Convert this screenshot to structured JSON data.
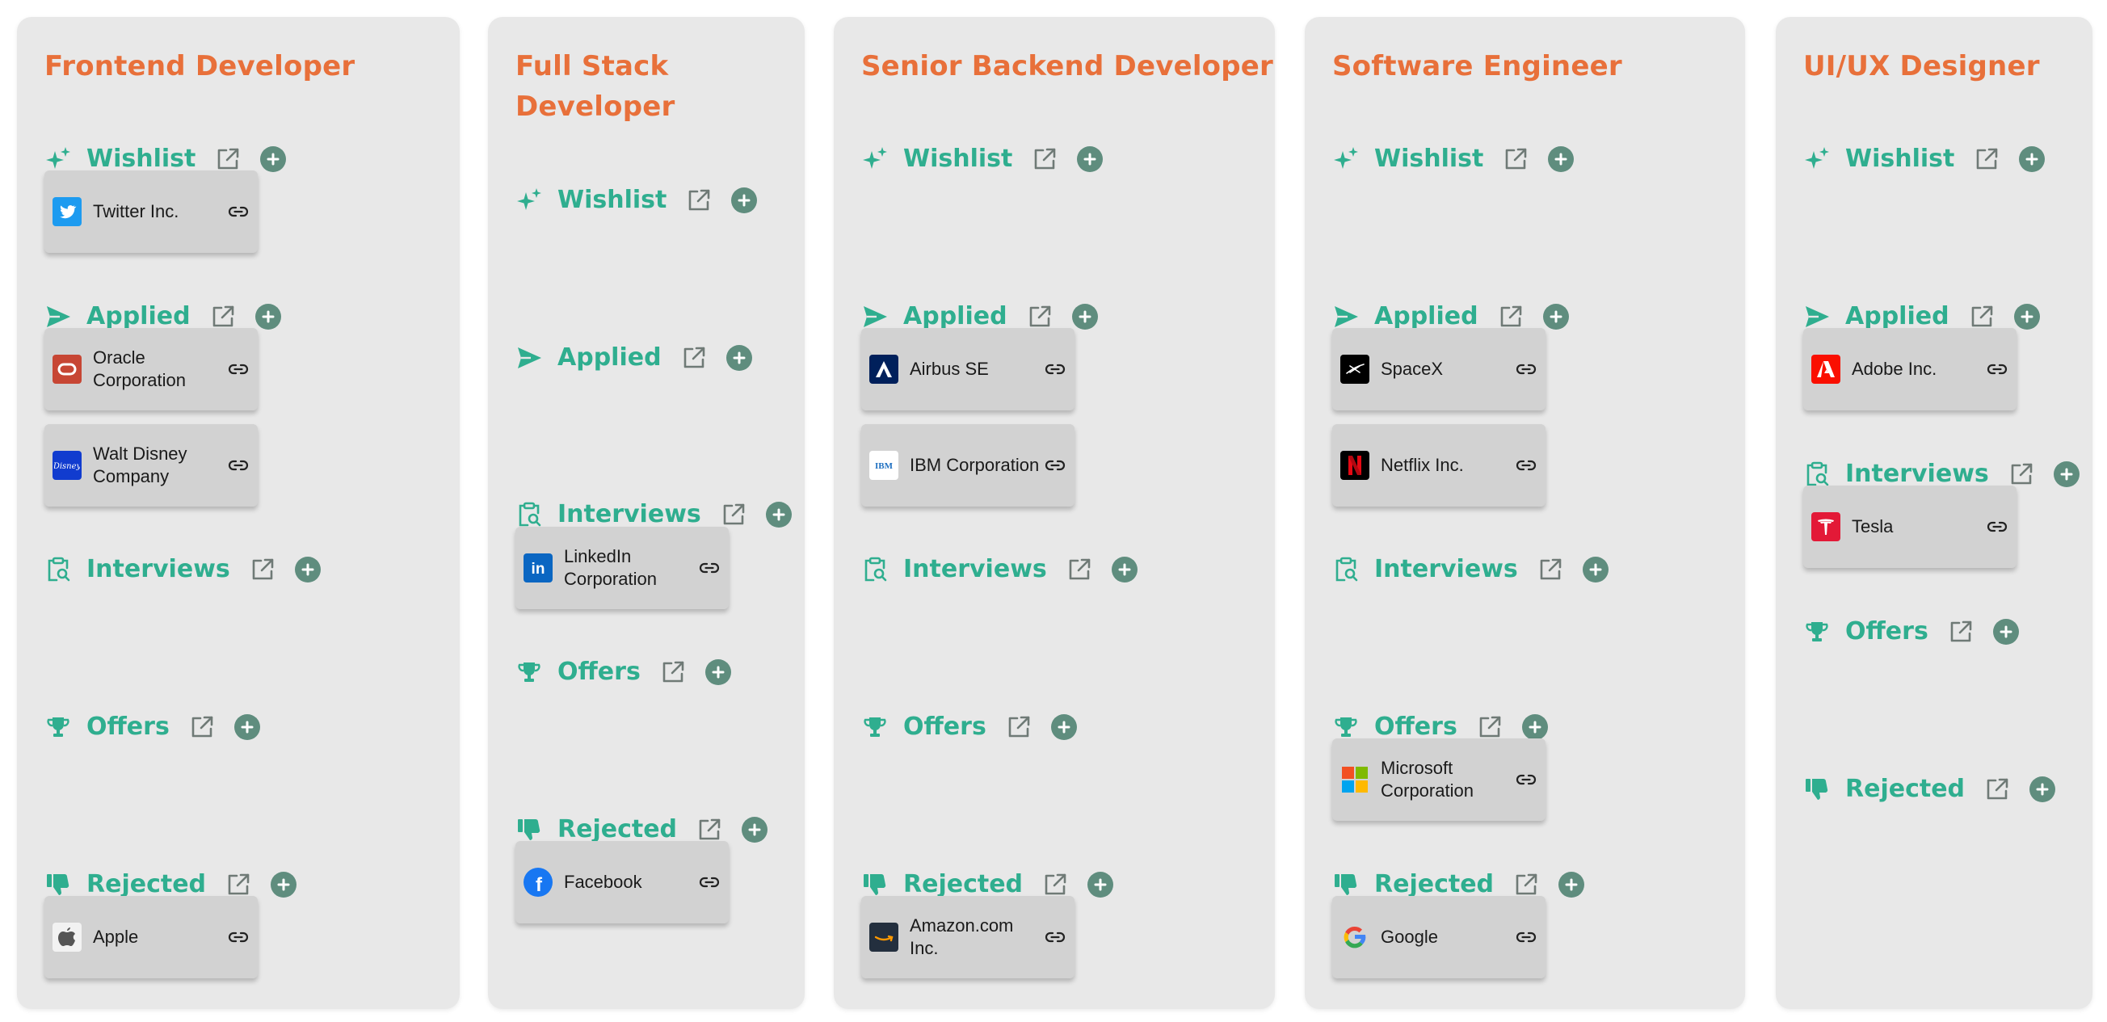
{
  "colors": {
    "title": "#e8703a",
    "section": "#2fae8f",
    "add_button": "#5f8d7e",
    "column_bg": "#e8e8e8",
    "card_bg": "#d2d2d2"
  },
  "columns": [
    {
      "title": "Frontend Developer",
      "sections": [
        {
          "label": "Wishlist",
          "icon": "sparkles-icon",
          "cards": [
            {
              "name": "Twitter Inc.",
              "logo": "twitter-logo"
            }
          ]
        },
        {
          "label": "Applied",
          "icon": "paper-plane-icon",
          "cards": [
            {
              "name": "Oracle Corporation",
              "logo": "oracle-logo"
            },
            {
              "name": "Walt Disney Company",
              "logo": "disney-logo"
            }
          ]
        },
        {
          "label": "Interviews",
          "icon": "clipboard-search-icon",
          "cards": []
        },
        {
          "label": "Offers",
          "icon": "trophy-icon",
          "cards": []
        },
        {
          "label": "Rejected",
          "icon": "thumbs-down-icon",
          "cards": [
            {
              "name": "Apple",
              "logo": "apple-logo"
            }
          ]
        }
      ]
    },
    {
      "title": "Full Stack Developer",
      "sections": [
        {
          "label": "Wishlist",
          "icon": "sparkles-icon",
          "cards": []
        },
        {
          "label": "Applied",
          "icon": "paper-plane-icon",
          "cards": []
        },
        {
          "label": "Interviews",
          "icon": "clipboard-search-icon",
          "cards": [
            {
              "name": "LinkedIn Corporation",
              "logo": "linkedin-logo"
            }
          ]
        },
        {
          "label": "Offers",
          "icon": "trophy-icon",
          "cards": []
        },
        {
          "label": "Rejected",
          "icon": "thumbs-down-icon",
          "cards": [
            {
              "name": "Facebook",
              "logo": "facebook-logo"
            }
          ]
        }
      ]
    },
    {
      "title": "Senior Backend Developer",
      "sections": [
        {
          "label": "Wishlist",
          "icon": "sparkles-icon",
          "cards": []
        },
        {
          "label": "Applied",
          "icon": "paper-plane-icon",
          "cards": [
            {
              "name": "Airbus SE",
              "logo": "airbus-logo"
            },
            {
              "name": "IBM Corporation",
              "logo": "ibm-logo"
            }
          ]
        },
        {
          "label": "Interviews",
          "icon": "clipboard-search-icon",
          "cards": []
        },
        {
          "label": "Offers",
          "icon": "trophy-icon",
          "cards": []
        },
        {
          "label": "Rejected",
          "icon": "thumbs-down-icon",
          "cards": [
            {
              "name": "Amazon.com Inc.",
              "logo": "amazon-logo"
            }
          ]
        }
      ]
    },
    {
      "title": "Software Engineer",
      "sections": [
        {
          "label": "Wishlist",
          "icon": "sparkles-icon",
          "cards": []
        },
        {
          "label": "Applied",
          "icon": "paper-plane-icon",
          "cards": [
            {
              "name": "SpaceX",
              "logo": "spacex-logo"
            },
            {
              "name": "Netflix Inc.",
              "logo": "netflix-logo"
            }
          ]
        },
        {
          "label": "Interviews",
          "icon": "clipboard-search-icon",
          "cards": []
        },
        {
          "label": "Offers",
          "icon": "trophy-icon",
          "cards": [
            {
              "name": "Microsoft Corporation",
              "logo": "microsoft-logo"
            }
          ]
        },
        {
          "label": "Rejected",
          "icon": "thumbs-down-icon",
          "cards": [
            {
              "name": "Google",
              "logo": "google-logo"
            }
          ]
        }
      ]
    },
    {
      "title": "UI/UX Designer",
      "sections": [
        {
          "label": "Wishlist",
          "icon": "sparkles-icon",
          "cards": []
        },
        {
          "label": "Applied",
          "icon": "paper-plane-icon",
          "cards": [
            {
              "name": "Adobe Inc.",
              "logo": "adobe-logo"
            }
          ]
        },
        {
          "label": "Interviews",
          "icon": "clipboard-search-icon",
          "cards": [
            {
              "name": "Tesla",
              "logo": "tesla-logo"
            }
          ]
        },
        {
          "label": "Offers",
          "icon": "trophy-icon",
          "cards": []
        },
        {
          "label": "Rejected",
          "icon": "thumbs-down-icon",
          "cards": []
        }
      ]
    }
  ]
}
